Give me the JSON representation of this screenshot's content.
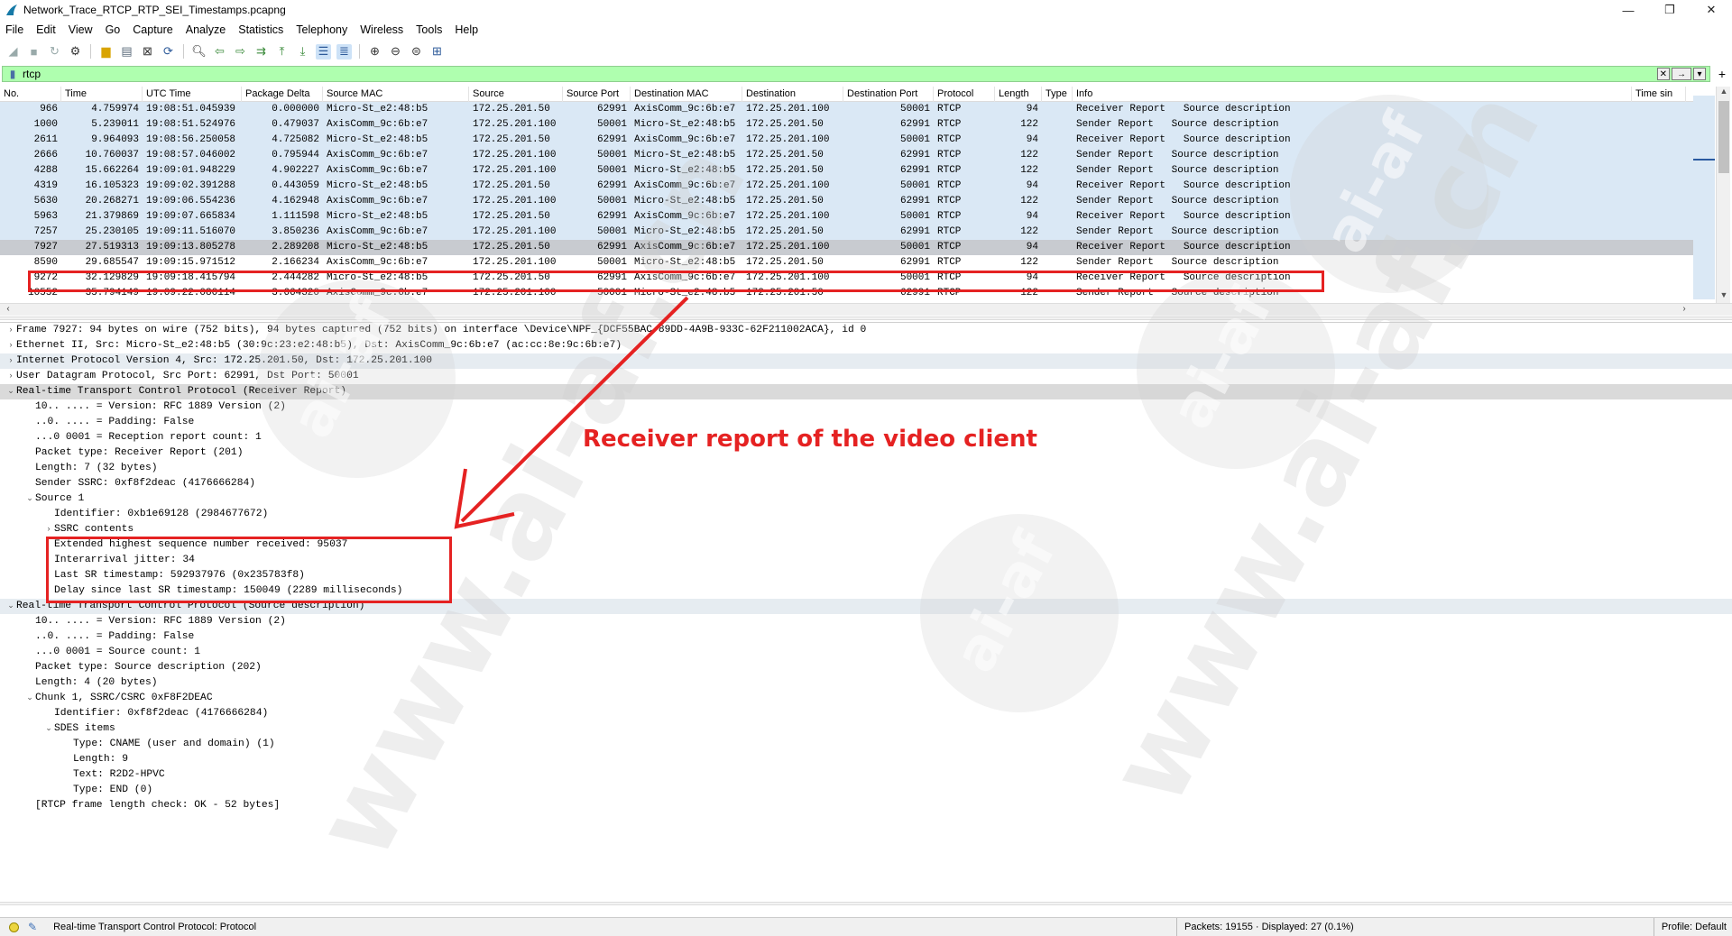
{
  "window": {
    "title": "Network_Trace_RTCP_RTP_SEI_Timestamps.pcapng",
    "minimize": "—",
    "maximize": "❐",
    "close": "✕"
  },
  "menu": [
    "File",
    "Edit",
    "View",
    "Go",
    "Capture",
    "Analyze",
    "Statistics",
    "Telephony",
    "Wireless",
    "Tools",
    "Help"
  ],
  "filter": {
    "value": "rtcp",
    "apply_label": "→"
  },
  "columns": [
    "No.",
    "Time",
    "UTC Time",
    "Package Delta",
    "Source MAC",
    "Source",
    "Source Port",
    "Destination MAC",
    "Destination",
    "Destination Port",
    "Protocol",
    "Length",
    "Type",
    "Info",
    "Time sin"
  ],
  "packets": [
    [
      "966",
      "4.759974",
      "19:08:51.045939",
      "0.000000",
      "Micro-St_e2:48:b5",
      "172.25.201.50",
      "62991",
      "AxisComm_9c:6b:e7",
      "172.25.201.100",
      "50001",
      "RTCP",
      "94",
      "",
      "Receiver Report   Source description",
      "rtcp"
    ],
    [
      "1000",
      "5.239011",
      "19:08:51.524976",
      "0.479037",
      "AxisComm_9c:6b:e7",
      "172.25.201.100",
      "50001",
      "Micro-St_e2:48:b5",
      "172.25.201.50",
      "62991",
      "RTCP",
      "122",
      "",
      "Sender Report   Source description",
      "rtcp"
    ],
    [
      "2611",
      "9.964093",
      "19:08:56.250058",
      "4.725082",
      "Micro-St_e2:48:b5",
      "172.25.201.50",
      "62991",
      "AxisComm_9c:6b:e7",
      "172.25.201.100",
      "50001",
      "RTCP",
      "94",
      "",
      "Receiver Report   Source description",
      "rtcp"
    ],
    [
      "2666",
      "10.760037",
      "19:08:57.046002",
      "0.795944",
      "AxisComm_9c:6b:e7",
      "172.25.201.100",
      "50001",
      "Micro-St_e2:48:b5",
      "172.25.201.50",
      "62991",
      "RTCP",
      "122",
      "",
      "Sender Report   Source description",
      "rtcp"
    ],
    [
      "4288",
      "15.662264",
      "19:09:01.948229",
      "4.902227",
      "AxisComm_9c:6b:e7",
      "172.25.201.100",
      "50001",
      "Micro-St_e2:48:b5",
      "172.25.201.50",
      "62991",
      "RTCP",
      "122",
      "",
      "Sender Report   Source description",
      "rtcp"
    ],
    [
      "4319",
      "16.105323",
      "19:09:02.391288",
      "0.443059",
      "Micro-St_e2:48:b5",
      "172.25.201.50",
      "62991",
      "AxisComm_9c:6b:e7",
      "172.25.201.100",
      "50001",
      "RTCP",
      "94",
      "",
      "Receiver Report   Source description",
      "rtcp"
    ],
    [
      "5630",
      "20.268271",
      "19:09:06.554236",
      "4.162948",
      "AxisComm_9c:6b:e7",
      "172.25.201.100",
      "50001",
      "Micro-St_e2:48:b5",
      "172.25.201.50",
      "62991",
      "RTCP",
      "122",
      "",
      "Sender Report   Source description",
      "rtcp"
    ],
    [
      "5963",
      "21.379869",
      "19:09:07.665834",
      "1.111598",
      "Micro-St_e2:48:b5",
      "172.25.201.50",
      "62991",
      "AxisComm_9c:6b:e7",
      "172.25.201.100",
      "50001",
      "RTCP",
      "94",
      "",
      "Receiver Report   Source description",
      "rtcp"
    ],
    [
      "7257",
      "25.230105",
      "19:09:11.516070",
      "3.850236",
      "AxisComm_9c:6b:e7",
      "172.25.201.100",
      "50001",
      "Micro-St_e2:48:b5",
      "172.25.201.50",
      "62991",
      "RTCP",
      "122",
      "",
      "Sender Report   Source description",
      "rtcp"
    ],
    [
      "7927",
      "27.519313",
      "19:09:13.805278",
      "2.289208",
      "Micro-St_e2:48:b5",
      "172.25.201.50",
      "62991",
      "AxisComm_9c:6b:e7",
      "172.25.201.100",
      "50001",
      "RTCP",
      "94",
      "",
      "Receiver Report   Source description",
      "sel"
    ],
    [
      "8590",
      "29.685547",
      "19:09:15.971512",
      "2.166234",
      "AxisComm_9c:6b:e7",
      "172.25.201.100",
      "50001",
      "Micro-St_e2:48:b5",
      "172.25.201.50",
      "62991",
      "RTCP",
      "122",
      "",
      "Sender Report   Source description",
      "plain"
    ],
    [
      "9272",
      "32.129829",
      "19:09:18.415794",
      "2.444282",
      "Micro-St_e2:48:b5",
      "172.25.201.50",
      "62991",
      "AxisComm_9c:6b:e7",
      "172.25.201.100",
      "50001",
      "RTCP",
      "94",
      "",
      "Receiver Report   Source description",
      "plain"
    ],
    [
      "10552",
      "35.794149",
      "19:09:22.080114",
      "3.664320",
      "AxisComm_9c:6b:e7",
      "172.25.201.100",
      "50001",
      "Micro-St_e2:48:b5",
      "172.25.201.50",
      "62991",
      "RTCP",
      "122",
      "",
      "Sender Report   Source description",
      "plain"
    ]
  ],
  "details": [
    {
      "indent": 0,
      "tw": "›",
      "text": "Frame 7927: 94 bytes on wire (752 bits), 94 bytes captured (752 bits) on interface \\Device\\NPF_{DCF55BAC-89DD-4A9B-933C-62F211002ACA}, id 0",
      "style": ""
    },
    {
      "indent": 0,
      "tw": "›",
      "text": "Ethernet II, Src: Micro-St_e2:48:b5 (30:9c:23:e2:48:b5), Dst: AxisComm_9c:6b:e7 (ac:cc:8e:9c:6b:e7)",
      "style": ""
    },
    {
      "indent": 0,
      "tw": "›",
      "text": "Internet Protocol Version 4, Src: 172.25.201.50, Dst: 172.25.201.100",
      "style": "hl"
    },
    {
      "indent": 0,
      "tw": "›",
      "text": "User Datagram Protocol, Src Port: 62991, Dst Port: 50001",
      "style": ""
    },
    {
      "indent": 0,
      "tw": "⌄",
      "text": "Real-time Transport Control Protocol (Receiver Report)",
      "style": "sel"
    },
    {
      "indent": 1,
      "tw": "",
      "text": "10.. .... = Version: RFC 1889 Version (2)",
      "style": ""
    },
    {
      "indent": 1,
      "tw": "",
      "text": "..0. .... = Padding: False",
      "style": ""
    },
    {
      "indent": 1,
      "tw": "",
      "text": "...0 0001 = Reception report count: 1",
      "style": ""
    },
    {
      "indent": 1,
      "tw": "",
      "text": "Packet type: Receiver Report (201)",
      "style": ""
    },
    {
      "indent": 1,
      "tw": "",
      "text": "Length: 7 (32 bytes)",
      "style": ""
    },
    {
      "indent": 1,
      "tw": "",
      "text": "Sender SSRC: 0xf8f2deac (4176666284)",
      "style": ""
    },
    {
      "indent": 1,
      "tw": "⌄",
      "text": "Source 1",
      "style": ""
    },
    {
      "indent": 2,
      "tw": "",
      "text": "Identifier: 0xb1e69128 (2984677672)",
      "style": ""
    },
    {
      "indent": 2,
      "tw": "›",
      "text": "SSRC contents",
      "style": ""
    },
    {
      "indent": 2,
      "tw": "",
      "text": "Extended highest sequence number received: 95037",
      "style": ""
    },
    {
      "indent": 2,
      "tw": "",
      "text": "Interarrival jitter: 34",
      "style": ""
    },
    {
      "indent": 2,
      "tw": "",
      "text": "Last SR timestamp: 592937976 (0x235783f8)",
      "style": ""
    },
    {
      "indent": 2,
      "tw": "",
      "text": "Delay since last SR timestamp: 150049 (2289 milliseconds)",
      "style": ""
    },
    {
      "indent": 0,
      "tw": "⌄",
      "text": "Real-time Transport Control Protocol (Source description)",
      "style": "hl"
    },
    {
      "indent": 1,
      "tw": "",
      "text": "10.. .... = Version: RFC 1889 Version (2)",
      "style": ""
    },
    {
      "indent": 1,
      "tw": "",
      "text": "..0. .... = Padding: False",
      "style": ""
    },
    {
      "indent": 1,
      "tw": "",
      "text": "...0 0001 = Source count: 1",
      "style": ""
    },
    {
      "indent": 1,
      "tw": "",
      "text": "Packet type: Source description (202)",
      "style": ""
    },
    {
      "indent": 1,
      "tw": "",
      "text": "Length: 4 (20 bytes)",
      "style": ""
    },
    {
      "indent": 1,
      "tw": "⌄",
      "text": "Chunk 1, SSRC/CSRC 0xF8F2DEAC",
      "style": ""
    },
    {
      "indent": 2,
      "tw": "",
      "text": "Identifier: 0xf8f2deac (4176666284)",
      "style": ""
    },
    {
      "indent": 2,
      "tw": "⌄",
      "text": "SDES items",
      "style": ""
    },
    {
      "indent": 3,
      "tw": "",
      "text": "Type: CNAME (user and domain) (1)",
      "style": ""
    },
    {
      "indent": 3,
      "tw": "",
      "text": "Length: 9",
      "style": ""
    },
    {
      "indent": 3,
      "tw": "",
      "text": "Text: R2D2-HPVC",
      "style": ""
    },
    {
      "indent": 3,
      "tw": "",
      "text": "Type: END (0)",
      "style": ""
    },
    {
      "indent": 1,
      "tw": "",
      "text": "[RTCP frame length check: OK - 52 bytes]",
      "style": ""
    }
  ],
  "annotation": {
    "label": "Receiver report of the video client",
    "color": "#e52222"
  },
  "watermark": {
    "texts": [
      "www.ai-af.cn",
      "ai-af"
    ]
  },
  "status": {
    "message": "Real-time Transport Control Protocol: Protocol",
    "packets": "Packets: 19155 · Displayed: 27 (0.1%)",
    "profile": "Profile: Default"
  },
  "colors": {
    "filter_bg": "#afffaf",
    "rtcp_row_bg": "#dae8f5",
    "selected_row_bg": "#c8cbd0"
  }
}
